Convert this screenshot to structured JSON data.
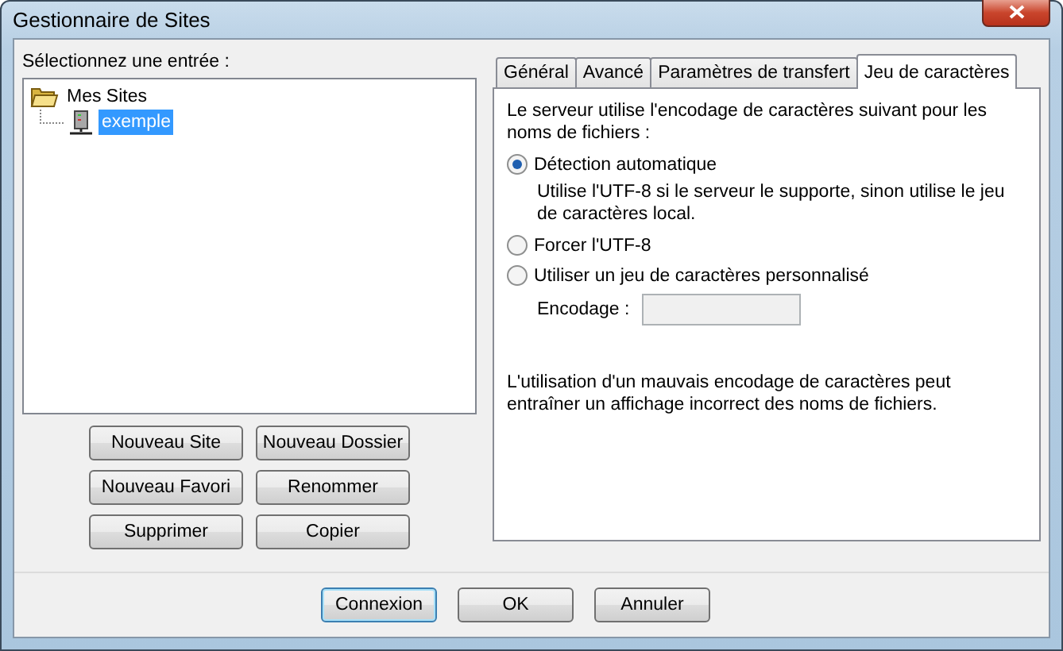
{
  "window": {
    "title": "Gestionnaire de Sites"
  },
  "site_tree": {
    "label": "Sélectionnez une entrée :",
    "items": [
      {
        "kind": "folder",
        "label": "Mes Sites",
        "selected": false,
        "expanded": true,
        "children": [
          {
            "kind": "server",
            "label": "exemple",
            "selected": true
          }
        ]
      }
    ]
  },
  "site_buttons": [
    "Nouveau Site",
    "Nouveau Dossier",
    "Nouveau Favori",
    "Renommer",
    "Supprimer",
    "Copier"
  ],
  "tabs": [
    {
      "label": "Général",
      "selected": false
    },
    {
      "label": "Avancé",
      "selected": false
    },
    {
      "label": "Paramètres de transfert",
      "selected": false
    },
    {
      "label": "Jeu de caractères",
      "selected": true
    }
  ],
  "charset": {
    "intro": "Le serveur utilise l'encodage de caractères suivant pour les noms de fichiers :",
    "options": [
      {
        "label": "Détection automatique",
        "selected": true,
        "description": "Utilise l'UTF-8 si le serveur le supporte, sinon utilise le jeu de caractères local."
      },
      {
        "label": "Forcer l'UTF-8",
        "selected": false
      },
      {
        "label": "Utiliser un jeu de caractères personnalisé",
        "selected": false
      }
    ],
    "encoding": {
      "label": "Encodage :",
      "disabled": true
    },
    "note": "L'utilisation d'un mauvais encodage de caractères peut entraîner un affichage incorrect des noms de fichiers."
  },
  "buttons": [
    {
      "label": "Connexion",
      "default": true
    },
    {
      "label": "OK",
      "default": false
    },
    {
      "label": "Annuler",
      "default": false
    }
  ]
}
